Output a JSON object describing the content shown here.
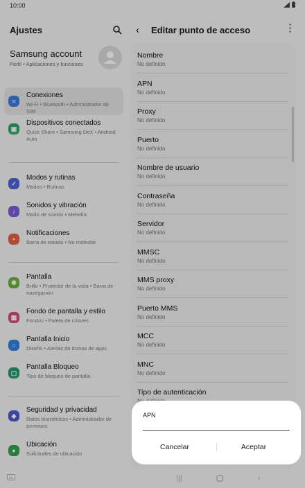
{
  "status_bar": {
    "time": "10:00"
  },
  "settings": {
    "title": "Ajustes",
    "account": {
      "name": "Samsung account",
      "sub": "Perfil • Aplicaciones y funciones"
    },
    "groups": [
      {
        "items": [
          {
            "title": "Conexiones",
            "sub": "Wi-Fi • Bluetooth • Administrador de SIM",
            "color": "#3b7ce0",
            "icon": "wifi-icon",
            "selected": true
          },
          {
            "title": "Dispositivos conectados",
            "sub": "Quick Share • Samsung DeX • Android Auto",
            "color": "#2fa36b",
            "icon": "devices-icon"
          }
        ]
      },
      {
        "items": [
          {
            "title": "Modos y rutinas",
            "sub": "Modos • Rutinas",
            "color": "#4c63d6",
            "icon": "check-circle-icon"
          },
          {
            "title": "Sonidos y vibración",
            "sub": "Modo de sonido • Melodía",
            "color": "#7b5ad6",
            "icon": "sound-icon"
          },
          {
            "title": "Notificaciones",
            "sub": "Barra de estado • No molestar",
            "color": "#e3613f",
            "icon": "bell-icon"
          }
        ]
      },
      {
        "items": [
          {
            "title": "Pantalla",
            "sub": "Brillo • Protector de la vista • Barra de navegación",
            "color": "#6bb036",
            "icon": "sun-icon"
          },
          {
            "title": "Fondo de pantalla y estilo",
            "sub": "Fondos • Paleta de colores",
            "color": "#d9487c",
            "icon": "image-icon"
          },
          {
            "title": "Pantalla Inicio",
            "sub": "Diseño • Alertas de iconos de apps",
            "color": "#2f7fe0",
            "icon": "home-icon"
          },
          {
            "title": "Pantalla Bloqueo",
            "sub": "Tipo de bloqueo de pantalla",
            "color": "#1f9a6a",
            "icon": "lock-icon"
          }
        ]
      },
      {
        "items": [
          {
            "title": "Seguridad y privacidad",
            "sub": "Datos biométricos • Administrador de permisos",
            "color": "#4b58c9",
            "icon": "shield-icon"
          },
          {
            "title": "Ubicación",
            "sub": "Solicitudes de ubicación",
            "color": "#35a04d",
            "icon": "location-icon"
          }
        ]
      }
    ]
  },
  "apn_editor": {
    "title": "Editar punto de acceso",
    "fields": [
      {
        "label": "Nombre",
        "value": "No definido"
      },
      {
        "label": "APN",
        "value": "No definido"
      },
      {
        "label": "Proxy",
        "value": "No definido"
      },
      {
        "label": "Puerto",
        "value": "No definido"
      },
      {
        "label": "Nombre de usuario",
        "value": "No definido"
      },
      {
        "label": "Contraseña",
        "value": "No definido"
      },
      {
        "label": "Servidor",
        "value": "No definido"
      },
      {
        "label": "MMSC",
        "value": "No definido"
      },
      {
        "label": "MMS proxy",
        "value": "No definido"
      },
      {
        "label": "Puerto MMS",
        "value": "No definido"
      },
      {
        "label": "MCC",
        "value": "No definido"
      },
      {
        "label": "MNC",
        "value": "No definido"
      },
      {
        "label": "Tipo de autenticación",
        "value": "No definido"
      }
    ]
  },
  "dialog": {
    "label": "APN",
    "value": "",
    "cancel": "Cancelar",
    "ok": "Aceptar"
  },
  "nav": {
    "recents": "recents-icon",
    "home": "home-button-icon",
    "back": "back-icon"
  }
}
